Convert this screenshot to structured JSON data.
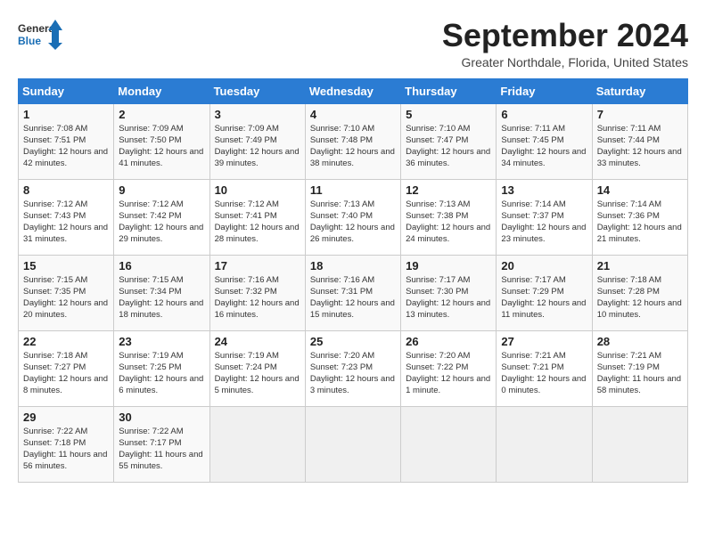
{
  "logo": {
    "line1": "General",
    "line2": "Blue"
  },
  "title": "September 2024",
  "subtitle": "Greater Northdale, Florida, United States",
  "days_of_week": [
    "Sunday",
    "Monday",
    "Tuesday",
    "Wednesday",
    "Thursday",
    "Friday",
    "Saturday"
  ],
  "weeks": [
    [
      {
        "day": "1",
        "sunrise": "7:08 AM",
        "sunset": "7:51 PM",
        "daylight": "12 hours and 42 minutes."
      },
      {
        "day": "2",
        "sunrise": "7:09 AM",
        "sunset": "7:50 PM",
        "daylight": "12 hours and 41 minutes."
      },
      {
        "day": "3",
        "sunrise": "7:09 AM",
        "sunset": "7:49 PM",
        "daylight": "12 hours and 39 minutes."
      },
      {
        "day": "4",
        "sunrise": "7:10 AM",
        "sunset": "7:48 PM",
        "daylight": "12 hours and 38 minutes."
      },
      {
        "day": "5",
        "sunrise": "7:10 AM",
        "sunset": "7:47 PM",
        "daylight": "12 hours and 36 minutes."
      },
      {
        "day": "6",
        "sunrise": "7:11 AM",
        "sunset": "7:45 PM",
        "daylight": "12 hours and 34 minutes."
      },
      {
        "day": "7",
        "sunrise": "7:11 AM",
        "sunset": "7:44 PM",
        "daylight": "12 hours and 33 minutes."
      }
    ],
    [
      {
        "day": "8",
        "sunrise": "7:12 AM",
        "sunset": "7:43 PM",
        "daylight": "12 hours and 31 minutes."
      },
      {
        "day": "9",
        "sunrise": "7:12 AM",
        "sunset": "7:42 PM",
        "daylight": "12 hours and 29 minutes."
      },
      {
        "day": "10",
        "sunrise": "7:12 AM",
        "sunset": "7:41 PM",
        "daylight": "12 hours and 28 minutes."
      },
      {
        "day": "11",
        "sunrise": "7:13 AM",
        "sunset": "7:40 PM",
        "daylight": "12 hours and 26 minutes."
      },
      {
        "day": "12",
        "sunrise": "7:13 AM",
        "sunset": "7:38 PM",
        "daylight": "12 hours and 24 minutes."
      },
      {
        "day": "13",
        "sunrise": "7:14 AM",
        "sunset": "7:37 PM",
        "daylight": "12 hours and 23 minutes."
      },
      {
        "day": "14",
        "sunrise": "7:14 AM",
        "sunset": "7:36 PM",
        "daylight": "12 hours and 21 minutes."
      }
    ],
    [
      {
        "day": "15",
        "sunrise": "7:15 AM",
        "sunset": "7:35 PM",
        "daylight": "12 hours and 20 minutes."
      },
      {
        "day": "16",
        "sunrise": "7:15 AM",
        "sunset": "7:34 PM",
        "daylight": "12 hours and 18 minutes."
      },
      {
        "day": "17",
        "sunrise": "7:16 AM",
        "sunset": "7:32 PM",
        "daylight": "12 hours and 16 minutes."
      },
      {
        "day": "18",
        "sunrise": "7:16 AM",
        "sunset": "7:31 PM",
        "daylight": "12 hours and 15 minutes."
      },
      {
        "day": "19",
        "sunrise": "7:17 AM",
        "sunset": "7:30 PM",
        "daylight": "12 hours and 13 minutes."
      },
      {
        "day": "20",
        "sunrise": "7:17 AM",
        "sunset": "7:29 PM",
        "daylight": "12 hours and 11 minutes."
      },
      {
        "day": "21",
        "sunrise": "7:18 AM",
        "sunset": "7:28 PM",
        "daylight": "12 hours and 10 minutes."
      }
    ],
    [
      {
        "day": "22",
        "sunrise": "7:18 AM",
        "sunset": "7:27 PM",
        "daylight": "12 hours and 8 minutes."
      },
      {
        "day": "23",
        "sunrise": "7:19 AM",
        "sunset": "7:25 PM",
        "daylight": "12 hours and 6 minutes."
      },
      {
        "day": "24",
        "sunrise": "7:19 AM",
        "sunset": "7:24 PM",
        "daylight": "12 hours and 5 minutes."
      },
      {
        "day": "25",
        "sunrise": "7:20 AM",
        "sunset": "7:23 PM",
        "daylight": "12 hours and 3 minutes."
      },
      {
        "day": "26",
        "sunrise": "7:20 AM",
        "sunset": "7:22 PM",
        "daylight": "12 hours and 1 minute."
      },
      {
        "day": "27",
        "sunrise": "7:21 AM",
        "sunset": "7:21 PM",
        "daylight": "12 hours and 0 minutes."
      },
      {
        "day": "28",
        "sunrise": "7:21 AM",
        "sunset": "7:19 PM",
        "daylight": "11 hours and 58 minutes."
      }
    ],
    [
      {
        "day": "29",
        "sunrise": "7:22 AM",
        "sunset": "7:18 PM",
        "daylight": "11 hours and 56 minutes."
      },
      {
        "day": "30",
        "sunrise": "7:22 AM",
        "sunset": "7:17 PM",
        "daylight": "11 hours and 55 minutes."
      },
      null,
      null,
      null,
      null,
      null
    ]
  ]
}
